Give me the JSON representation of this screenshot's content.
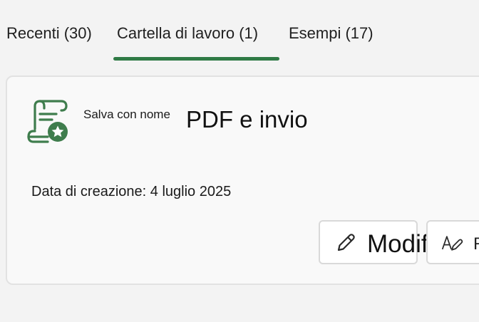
{
  "tabs": [
    {
      "label": "Recenti (30)",
      "selected": false
    },
    {
      "label": "Cartella di lavoro (1)",
      "selected": true
    },
    {
      "label": "Esempi (17)",
      "selected": false
    }
  ],
  "colors": {
    "accent": "#2f7a45",
    "icon": "#3f7d4d"
  },
  "card": {
    "icon": "scroll-document-star-icon",
    "save_as_label": "Salva con nome",
    "title": "PDF e invio",
    "created_label": "Data di creazione: 4 luglio 2025",
    "actions": {
      "edit": {
        "label": "Modifica",
        "icon": "pencil-icon"
      },
      "second": {
        "label": "R",
        "icon": "text-style-icon"
      }
    }
  }
}
